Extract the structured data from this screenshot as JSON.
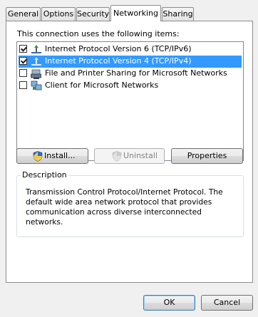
{
  "tabs": [
    {
      "label": "General",
      "active": false
    },
    {
      "label": "Options",
      "active": false
    },
    {
      "label": "Security",
      "active": false
    },
    {
      "label": "Networking",
      "active": true
    },
    {
      "label": "Sharing",
      "active": false
    }
  ],
  "panel": {
    "connection_label": "This connection uses the following items:",
    "items": [
      {
        "label": "Internet Protocol Version 6 (TCP/IPv6)",
        "checked": true,
        "selected": false,
        "icon": "protocol-icon"
      },
      {
        "label": "Internet Protocol Version 4 (TCP/IPv4)",
        "checked": true,
        "selected": true,
        "icon": "protocol-icon"
      },
      {
        "label": "File and Printer Sharing for Microsoft Networks",
        "checked": false,
        "selected": false,
        "icon": "file-printer-sharing-icon"
      },
      {
        "label": "Client for Microsoft Networks",
        "checked": false,
        "selected": false,
        "icon": "network-client-icon"
      }
    ],
    "install_label": "Install...",
    "uninstall_label": "Uninstall",
    "properties_label": "Properties",
    "description": {
      "legend": "Description",
      "text": "Transmission Control Protocol/Internet Protocol. The default wide area network protocol that provides communication across diverse interconnected networks."
    }
  },
  "footer": {
    "ok_label": "OK",
    "cancel_label": "Cancel"
  },
  "colors": {
    "selection": "#3399ff",
    "panel_background": "#ffffff",
    "dialog_background": "#f0f0f0"
  }
}
